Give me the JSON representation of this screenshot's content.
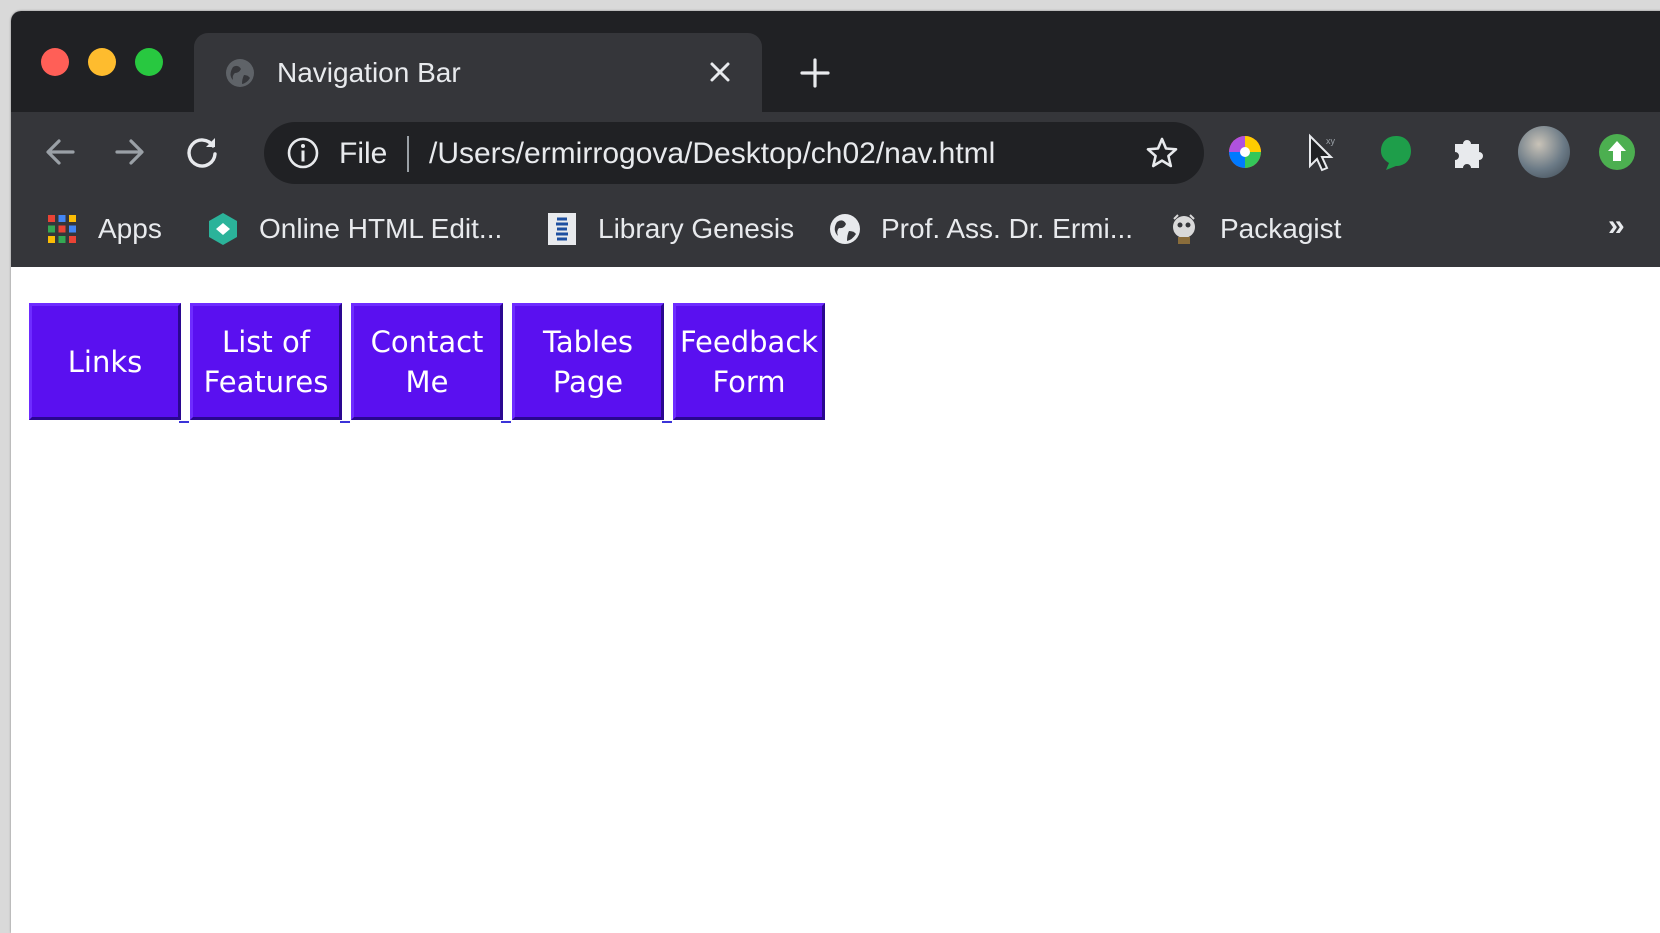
{
  "browser": {
    "tab": {
      "title": "Navigation Bar"
    },
    "omnibox": {
      "scheme_label": "File",
      "url": "/Users/ermirrogova/Desktop/ch02/nav.html"
    },
    "bookmarks": [
      {
        "label": "Apps",
        "icon": "apps-grid-icon"
      },
      {
        "label": "Online HTML Edit...",
        "icon": "html-editor-icon"
      },
      {
        "label": "Library Genesis",
        "icon": "library-genesis-icon"
      },
      {
        "label": "Prof. Ass. Dr. Ermi...",
        "icon": "globe-icon"
      },
      {
        "label": "Packagist",
        "icon": "packagist-icon"
      }
    ],
    "bookmarks_overflow": "»",
    "colors": {
      "frame": "#202124",
      "toolbar": "#35363a",
      "text": "#e8eaed"
    }
  },
  "nav": {
    "items": [
      {
        "line1": "Links",
        "line2": ""
      },
      {
        "line1": "List of",
        "line2": "Features"
      },
      {
        "line1": "Contact",
        "line2": "Me"
      },
      {
        "line1": "Tables",
        "line2": "Page"
      },
      {
        "line1": "Feedback",
        "line2": "Form"
      }
    ],
    "button_color": "#5a10f0"
  }
}
